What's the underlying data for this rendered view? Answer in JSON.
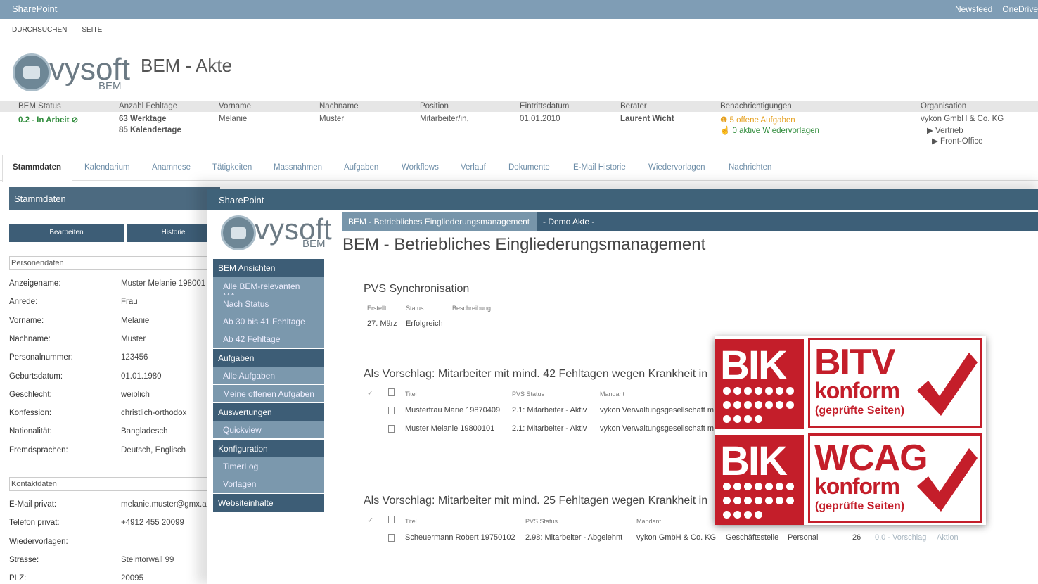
{
  "suitebar": {
    "brand": "SharePoint",
    "newsfeed": "Newsfeed",
    "onedrive": "OneDrive"
  },
  "ribbon": {
    "browse": "DURCHSUCHEN",
    "page": "SEITE"
  },
  "logo": {
    "vysoft": "vysoft",
    "bem": "BEM"
  },
  "page1": {
    "title": "BEM - Akte"
  },
  "infobar": {
    "headers": [
      "BEM Status",
      "Anzahl Fehltage",
      "Vorname",
      "Nachname",
      "Position",
      "Eintrittsdatum",
      "Berater",
      "Benachrichtigungen",
      "Organisation"
    ],
    "status": "0.2 - In Arbeit",
    "werktage": "63 Werktage",
    "kalendertage": "85 Kalendertage",
    "vorname": "Melanie",
    "nachname": "Muster",
    "position": "Mitarbeiter/in,",
    "eintritt": "01.01.2010",
    "berater": "Laurent Wicht",
    "aufgaben": "5 offene Aufgaben",
    "wiedervorlagen": "0 aktive Wiedervorlagen",
    "org": "vykon GmbH & Co. KG",
    "org_sub1": "Vertrieb",
    "org_sub2": "Front-Office"
  },
  "tabs": [
    "Stammdaten",
    "Kalendarium",
    "Anamnese",
    "Tätigkeiten",
    "Massnahmen",
    "Aufgaben",
    "Workflows",
    "Verlauf",
    "Dokumente",
    "E-Mail Historie",
    "Wiedervorlagen",
    "Nachrichten"
  ],
  "stammdaten": {
    "header": "Stammdaten",
    "edit_btn": "Bearbeiten",
    "history_btn": "Historie",
    "sec_person": "Personendaten",
    "sec_contact": "Kontaktdaten",
    "person": [
      [
        "Anzeigename:",
        "Muster Melanie 198001"
      ],
      [
        "Anrede:",
        "Frau"
      ],
      [
        "Vorname:",
        "Melanie"
      ],
      [
        "Nachname:",
        "Muster"
      ],
      [
        "Personalnummer:",
        "123456"
      ],
      [
        "Geburtsdatum:",
        "01.01.1980"
      ],
      [
        "Geschlecht:",
        "weiblich"
      ],
      [
        "Konfession:",
        "christlich-orthodox"
      ],
      [
        "Nationalität:",
        "Bangladesch"
      ],
      [
        "Fremdsprachen:",
        "Deutsch, Englisch"
      ]
    ],
    "contact": [
      [
        "E-Mail privat:",
        "melanie.muster@gmx.a"
      ],
      [
        "Telefon privat:",
        "+4912 455 20099"
      ],
      [
        "Wiedervorlagen:",
        ""
      ],
      [
        "Strasse:",
        "Steintorwall 99"
      ],
      [
        "PLZ:",
        "20095"
      ]
    ]
  },
  "front": {
    "suitebar": "SharePoint",
    "bc1": "BEM - Betriebliches Eingliederungsmanagement",
    "bc2": "- Demo Akte -",
    "title": "BEM - Betriebliches Eingliederungsmanagement",
    "nav": [
      {
        "head": "BEM Ansichten",
        "items": [
          "Alle BEM-relevanten MA",
          "Nach Status",
          "Ab 30 bis 41 Fehltage",
          "Ab 42 Fehltage"
        ]
      },
      {
        "head": "Aufgaben",
        "items": [
          "Alle Aufgaben",
          "Meine offenen Aufgaben"
        ]
      },
      {
        "head": "Auswertungen",
        "items": [
          "Quickview"
        ]
      },
      {
        "head": "Konfiguration",
        "items": [
          "TimerLog",
          "Vorlagen"
        ]
      },
      {
        "head": "Websiteinhalte",
        "items": []
      }
    ],
    "pvs": {
      "title": "PVS Synchronisation",
      "h": [
        "Erstellt",
        "Status",
        "Beschreibung"
      ],
      "row": [
        "27. März",
        "Erfolgreich"
      ]
    },
    "list42": {
      "title": "Als Vorschlag: Mitarbeiter mit mind. 42 Fehltagen wegen Krankheit in",
      "h": [
        "Titel",
        "PVS Status",
        "Mandant"
      ],
      "rows": [
        [
          "Musterfrau Marie 19870409",
          "2.1: Mitarbeiter - Aktiv",
          "vykon Verwaltungsgesellschaft m"
        ],
        [
          "Muster Melanie 19800101",
          "2.1: Mitarbeiter - Aktiv",
          "vykon Verwaltungsgesellschaft m"
        ]
      ]
    },
    "list25": {
      "title": "Als Vorschlag: Mitarbeiter mit mind. 25 Fehltagen wegen Krankheit in",
      "h": [
        "Titel",
        "PVS Status",
        "Mandant"
      ],
      "row": [
        "Scheuermann Robert 19750102",
        "2.98: Mitarbeiter - Abgelehnt",
        "vykon GmbH & Co. KG",
        "Geschäftsstelle",
        "Personal",
        "26",
        "0.0 - Vorschlag",
        "Aktion"
      ]
    }
  },
  "badge": {
    "bik": "BIK",
    "bitv": "BITV",
    "wcag": "WCAG",
    "konform": "konform",
    "note": "(geprüfte Seiten)",
    "red": "#c41e2a"
  }
}
